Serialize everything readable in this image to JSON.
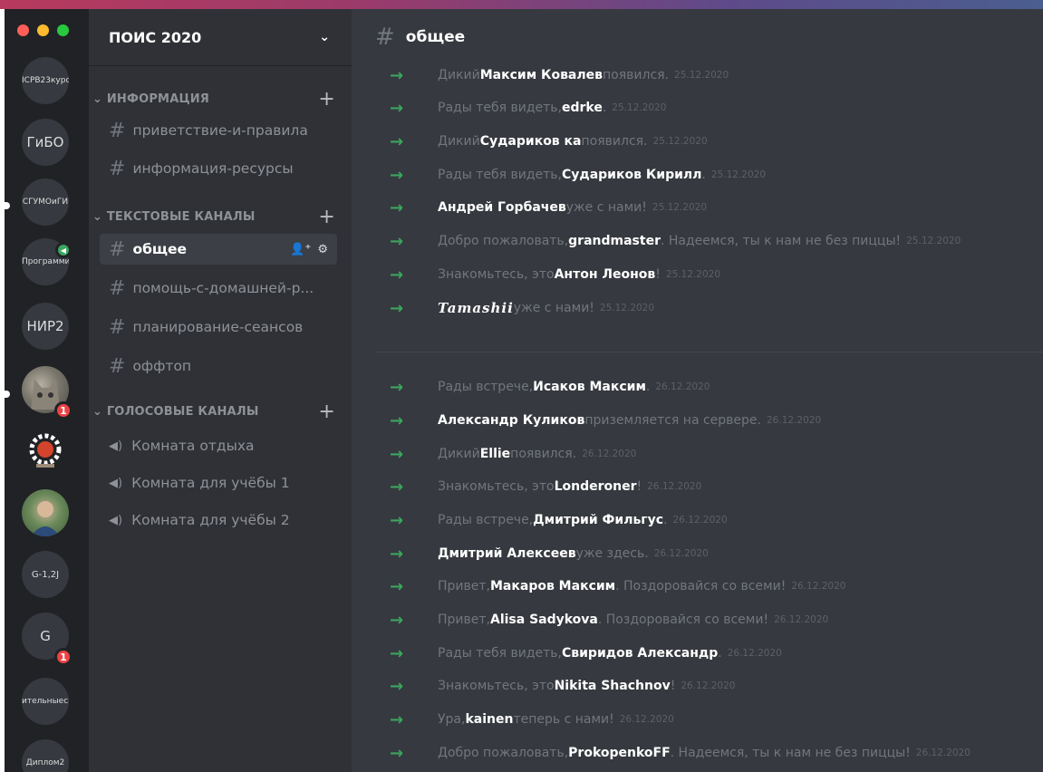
{
  "colors": {
    "accent_green": "#3ba55d",
    "badge_red": "#ed4245",
    "mac_red": "#ff5f57",
    "mac_yellow": "#febc2e",
    "mac_green": "#28c840"
  },
  "servers": [
    {
      "label": "ICPB23курс"
    },
    {
      "label": "ГиБО"
    },
    {
      "label": "СГУМОиГИ"
    },
    {
      "label": "Программиро"
    },
    {
      "label": "НИР2"
    },
    {
      "label": "cat-avatar",
      "badge": "1"
    },
    {
      "label": "gear-logo"
    },
    {
      "label": "person-avatar"
    },
    {
      "label": "G-1,2J"
    },
    {
      "label": "G",
      "badge": "1"
    },
    {
      "label": "ительныесі"
    },
    {
      "label": "Диплом2"
    }
  ],
  "guild": {
    "name": "ПОИС 2020"
  },
  "categories": {
    "info": "ИНФОРМАЦИЯ",
    "text": "ТЕКСТОВЫЕ КАНАЛЫ",
    "voice": "ГОЛОСОВЫЕ КАНАЛЫ"
  },
  "channels": {
    "info": [
      "приветствие-и-правила",
      "информация-ресурсы"
    ],
    "text": [
      "общее",
      "помощь-с-домашней-р...",
      "планирование-сеансов",
      "оффтоп"
    ],
    "voice": [
      "Комната отдыха",
      "Комната для учёбы 1",
      "Комната для учёбы 2"
    ]
  },
  "chat": {
    "channel": "общее",
    "messages": [
      {
        "pre": "Дикий ",
        "name": "Максим Ковалев",
        "post": " появился.",
        "ts": "25.12.2020"
      },
      {
        "pre": "Рады тебя видеть, ",
        "name": "edrke",
        "post": ".",
        "ts": "25.12.2020"
      },
      {
        "pre": "Дикий ",
        "name": "Судариков ка",
        "post": " появился.",
        "ts": "25.12.2020"
      },
      {
        "pre": "Рады тебя видеть, ",
        "name": "Судариков Кирилл",
        "post": ".",
        "ts": "25.12.2020"
      },
      {
        "pre": "",
        "name": "Андрей Горбачев",
        "post": " уже с нами!",
        "ts": "25.12.2020"
      },
      {
        "pre": "Добро пожаловать, ",
        "name": "grandmaster",
        "post": ". Надеемся, ты к нам не без пиццы!",
        "ts": "25.12.2020"
      },
      {
        "pre": "Знакомьтесь, это ",
        "name": "Антон Леонов",
        "post": "!",
        "ts": "25.12.2020"
      },
      {
        "pre": "",
        "name": "Tamashii",
        "post": " уже с нами!",
        "ts": "25.12.2020"
      },
      {
        "pre": "Рады встрече, ",
        "name": "Исаков Максим",
        "post": ".",
        "ts": "26.12.2020"
      },
      {
        "pre": "",
        "name": "Александр Куликов",
        "post": " приземляется на сервере.",
        "ts": "26.12.2020"
      },
      {
        "pre": "Дикий ",
        "name": "Ellie",
        "post": " появился.",
        "ts": "26.12.2020"
      },
      {
        "pre": "Знакомьтесь, это ",
        "name": "Londeroner",
        "post": "!",
        "ts": "26.12.2020"
      },
      {
        "pre": "Рады встрече, ",
        "name": "Дмитрий Фильгус",
        "post": ".",
        "ts": "26.12.2020"
      },
      {
        "pre": "",
        "name": "Дмитрий Алексеев",
        "post": " уже здесь.",
        "ts": "26.12.2020"
      },
      {
        "pre": "Привет, ",
        "name": "Макаров Максим",
        "post": ". Поздоровайся со всеми!",
        "ts": "26.12.2020"
      },
      {
        "pre": "Привет, ",
        "name": "Alisa Sadykova",
        "post": ". Поздоровайся со всеми!",
        "ts": "26.12.2020"
      },
      {
        "pre": "Рады тебя видеть, ",
        "name": "Свиридов Александр",
        "post": ".",
        "ts": "26.12.2020"
      },
      {
        "pre": "Знакомьтесь, это ",
        "name": "Nikita Shachnov",
        "post": "!",
        "ts": "26.12.2020"
      },
      {
        "pre": "Ура, ",
        "name": "kainen",
        "post": " теперь с нами!",
        "ts": "26.12.2020"
      },
      {
        "pre": "Добро пожаловать, ",
        "name": "ProkopenkoFF",
        "post": ". Надеемся, ты к нам не без пиццы!",
        "ts": "26.12.2020"
      }
    ]
  }
}
